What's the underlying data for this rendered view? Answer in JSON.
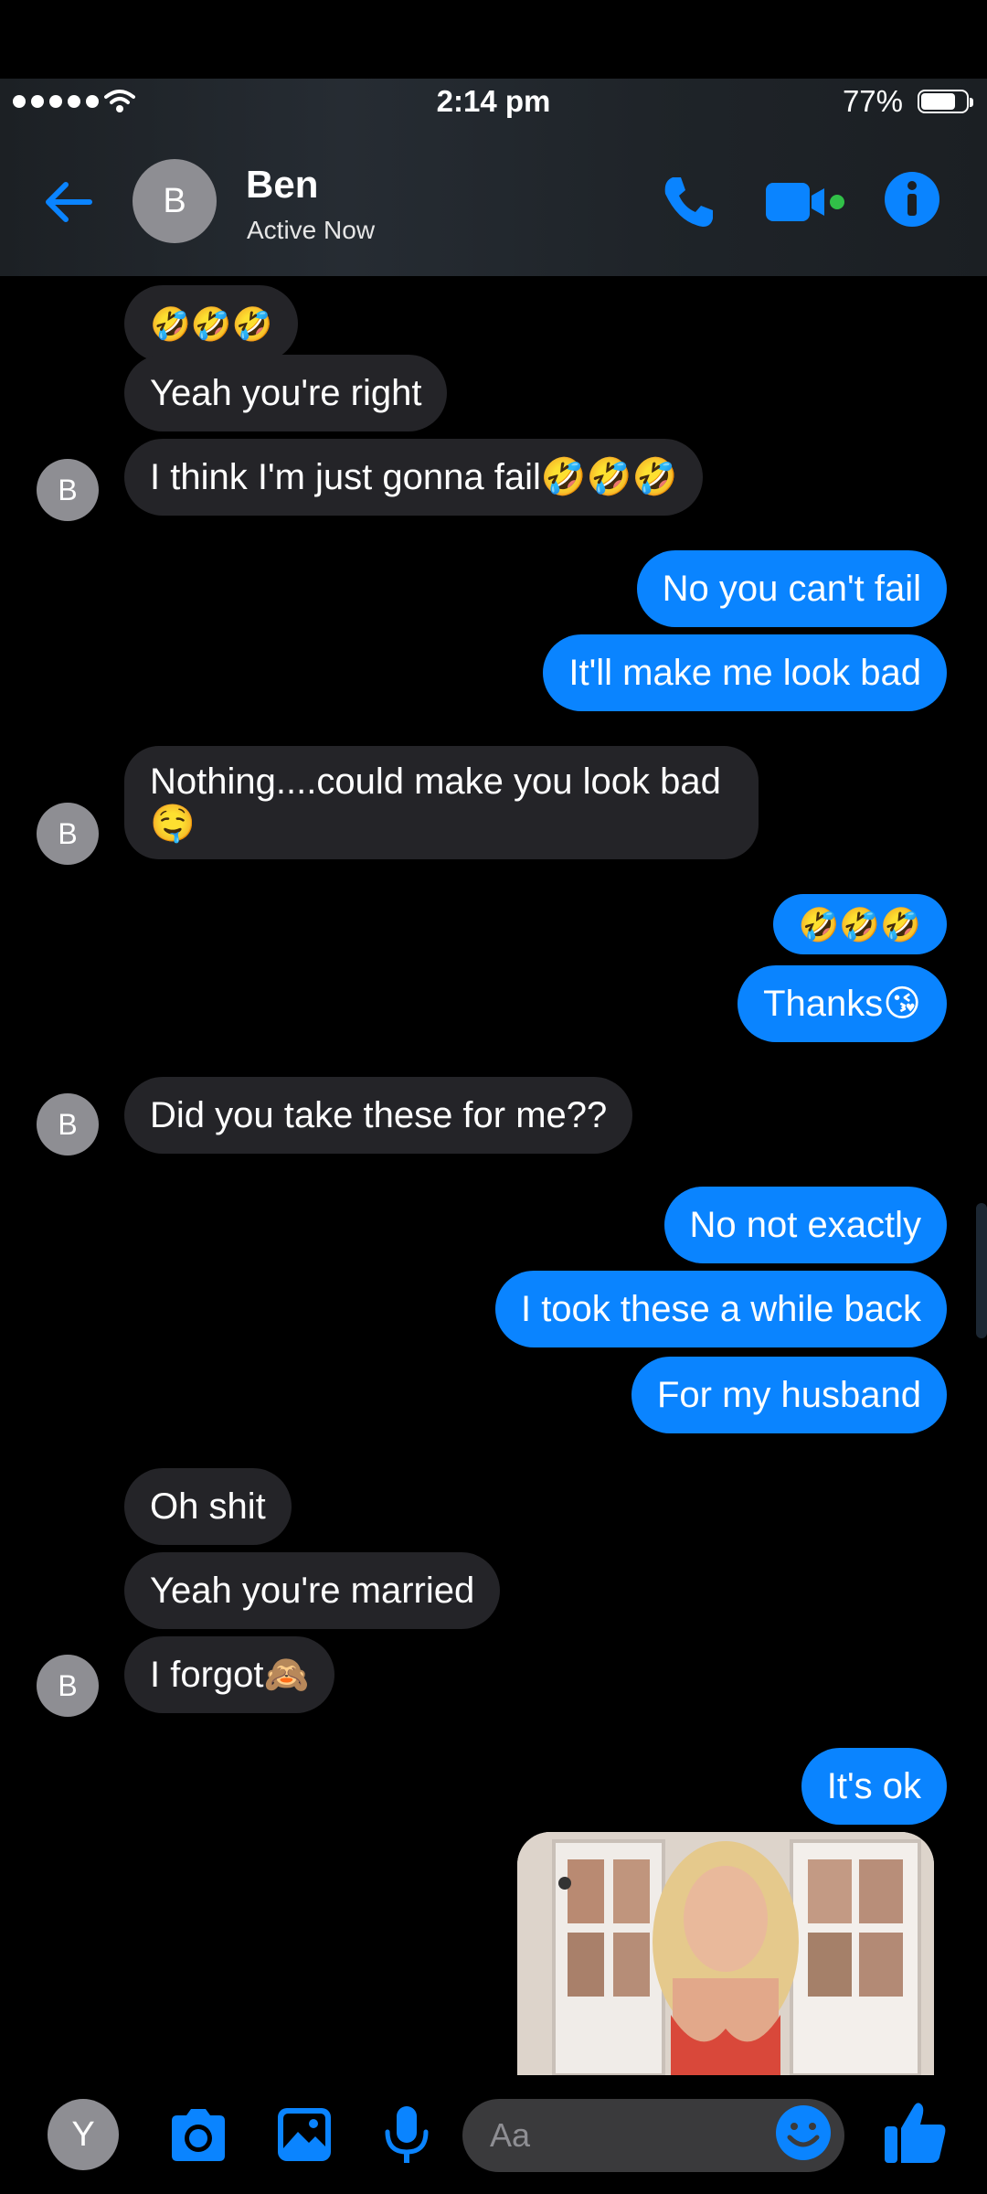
{
  "status_bar": {
    "time": "2:14 pm",
    "battery_percent": "77%",
    "battery_level": 0.77
  },
  "header": {
    "avatar_initial": "B",
    "contact_name": "Ben",
    "contact_status": "Active Now",
    "icons": [
      "back-arrow-icon",
      "phone-icon",
      "video-camera-icon",
      "info-icon"
    ],
    "accent_color": "#0a84ff"
  },
  "messages": [
    {
      "side": "in",
      "text": "🤣🤣🤣"
    },
    {
      "side": "in",
      "text": "Yeah you're right"
    },
    {
      "side": "in",
      "text": "I think I'm just gonna fail🤣🤣🤣",
      "avatar": "B"
    },
    {
      "side": "out",
      "text": "No you can't fail"
    },
    {
      "side": "out",
      "text": "It'll make me look bad"
    },
    {
      "side": "in",
      "text": "Nothing....could make you look bad 🤤",
      "avatar": "B"
    },
    {
      "side": "out",
      "text": "🤣🤣🤣"
    },
    {
      "side": "out",
      "text": "Thanks😘"
    },
    {
      "side": "in",
      "text": "Did you take these for me??",
      "avatar": "B"
    },
    {
      "side": "out",
      "text": "No not exactly"
    },
    {
      "side": "out",
      "text": "I took these a while back"
    },
    {
      "side": "out",
      "text": "For my husband"
    },
    {
      "side": "in",
      "text": "Oh shit"
    },
    {
      "side": "in",
      "text": "Yeah you're married"
    },
    {
      "side": "in",
      "text": "I forgot🙈",
      "avatar": "B"
    },
    {
      "side": "out",
      "text": "It's ok"
    },
    {
      "side": "out",
      "type": "photo"
    }
  ],
  "composer": {
    "user_initial": "Y",
    "placeholder": "Aa",
    "icons": [
      "camera-icon",
      "image-icon",
      "microphone-icon",
      "emoji-icon",
      "thumbs-up-icon"
    ]
  }
}
